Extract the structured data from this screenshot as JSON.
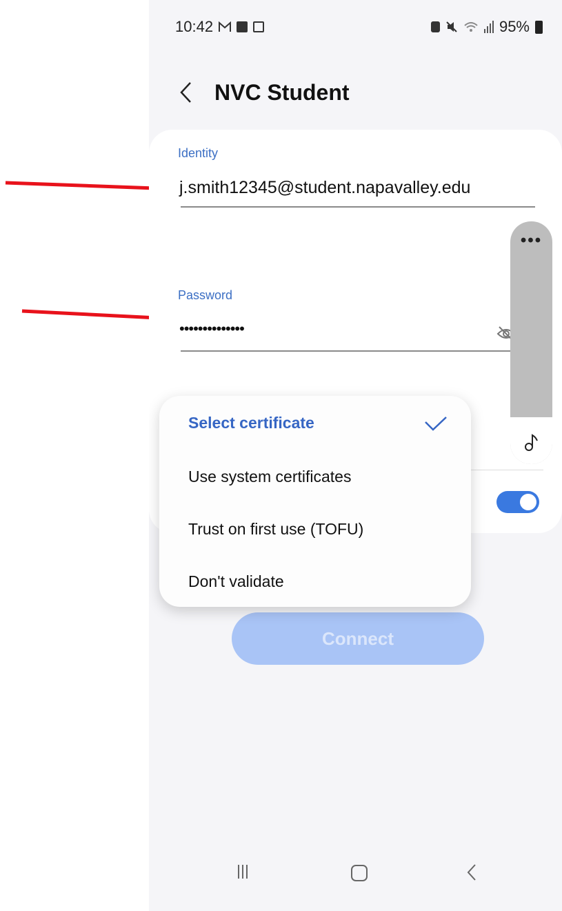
{
  "status_bar": {
    "time": "10:42",
    "left_icons": [
      "gmail-icon",
      "gallery-icon",
      "calendar-icon"
    ],
    "right_icons": [
      "battery-saver-icon",
      "mute-icon",
      "wifi-icon",
      "signal-icon"
    ],
    "battery": "95%"
  },
  "header": {
    "title": "NVC Student"
  },
  "form": {
    "identity_label": "Identity",
    "identity_value": "j.smith12345@student.napavalley.edu",
    "password_label": "Password",
    "password_value": "••••••••••••••",
    "toggle_on": true
  },
  "dropdown": {
    "items": [
      {
        "label": "Select certificate",
        "selected": true
      },
      {
        "label": "Use system certificates",
        "selected": false
      },
      {
        "label": "Trust on first use (TOFU)",
        "selected": false
      },
      {
        "label": "Don't validate",
        "selected": false
      }
    ]
  },
  "connect_label": "Connect",
  "side_panel": {
    "dots": "•••"
  },
  "colors": {
    "accent": "#3a79e0",
    "label": "#3c6fc4",
    "connect_disabled": "#a9c4f6",
    "annotation_arrow": "#e8121b"
  }
}
